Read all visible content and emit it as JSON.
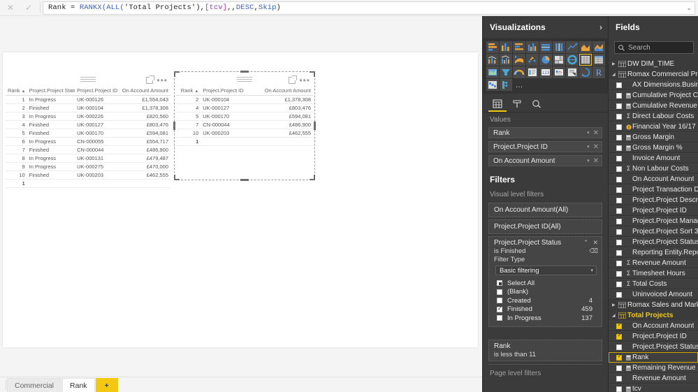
{
  "formula_bar": {
    "cancel_icon": "cancel-x-icon",
    "commit_icon": "commit-check-icon",
    "measure_name": "Rank ",
    "equals": "= ",
    "fn_rankx": "RANKX(",
    "all_open": "ALL(",
    "table_ref": "'Total Projects')",
    "comma1": ",",
    "field_tcv": "[tcv]",
    "tail": ",,",
    "desc": "DESC",
    "comma2": ",",
    "skip": "Skip",
    "close": ")",
    "expand_icon": "chevron-down-icon"
  },
  "canvas": {
    "page_tabs": [
      {
        "label": "Commercial",
        "state": "inactive"
      },
      {
        "label": "Rank",
        "state": "active"
      },
      {
        "label": "+",
        "state": "add"
      }
    ],
    "visual_1": {
      "drag_handle": "drag-handle-icon",
      "focus_icon": "focus-mode-icon",
      "more_icon": "more-options-icon",
      "columns": [
        "Rank",
        "Project.Project Status",
        "Project.Project ID",
        "On Account Amount"
      ],
      "sort_indicator": "▲",
      "rows": [
        [
          "1",
          "In Progress",
          "UK-000126",
          "£1,554,043"
        ],
        [
          "2",
          "Finished",
          "UK-000104",
          "£1,378,308"
        ],
        [
          "3",
          "In Progress",
          "UK-000226",
          "£820,560"
        ],
        [
          "4",
          "Finished",
          "UK-000127",
          "£803,476"
        ],
        [
          "5",
          "Finished",
          "UK-000170",
          "£594,081"
        ],
        [
          "6",
          "In Progress",
          "CN-000055",
          "£554,717"
        ],
        [
          "7",
          "Finished",
          "CN-000044",
          "£486,900"
        ],
        [
          "8",
          "In Progress",
          "UK-000131",
          "£479,487"
        ],
        [
          "9",
          "In Progress",
          "UK-000275",
          "£470,000"
        ],
        [
          "10",
          "Finished",
          "UK-000203",
          "£462,555"
        ]
      ],
      "total_row": [
        "1",
        "",
        "",
        ""
      ]
    },
    "visual_2": {
      "drag_handle": "drag-handle-icon",
      "focus_icon": "focus-mode-icon",
      "more_icon": "more-options-icon",
      "selected": true,
      "columns": [
        "Rank",
        "Project.Project ID",
        "On Account Amount"
      ],
      "sort_indicator": "▲",
      "rows": [
        [
          "2",
          "UK-000104",
          "£1,378,308"
        ],
        [
          "4",
          "UK-000127",
          "£803,476"
        ],
        [
          "5",
          "UK-000170",
          "£594,081"
        ],
        [
          "7",
          "CN-000044",
          "£486,900"
        ],
        [
          "10",
          "UK-000203",
          "£462,555"
        ]
      ],
      "total_row": [
        "1",
        "",
        ""
      ]
    }
  },
  "visualizations": {
    "title": "Visualizations",
    "collapse_icon": "chevron-right-icon",
    "gallery": [
      {
        "name": "stacked-bar-chart-icon",
        "selected": false
      },
      {
        "name": "stacked-column-chart-icon",
        "selected": false
      },
      {
        "name": "clustered-bar-chart-icon",
        "selected": false
      },
      {
        "name": "clustered-column-chart-icon",
        "selected": false
      },
      {
        "name": "100-stacked-bar-chart-icon",
        "selected": false
      },
      {
        "name": "100-stacked-column-chart-icon",
        "selected": false
      },
      {
        "name": "line-chart-icon",
        "selected": false
      },
      {
        "name": "area-chart-icon",
        "selected": false
      },
      {
        "name": "stacked-area-chart-icon",
        "selected": false
      },
      {
        "name": "line-stacked-column-chart-icon",
        "selected": false
      },
      {
        "name": "line-clustered-column-chart-icon",
        "selected": false
      },
      {
        "name": "ribbon-chart-icon",
        "selected": false
      },
      {
        "name": "scatter-chart-icon",
        "selected": false
      },
      {
        "name": "pie-chart-icon",
        "selected": false
      },
      {
        "name": "treemap-icon",
        "selected": false
      },
      {
        "name": "donut-chart-icon",
        "selected": false
      },
      {
        "name": "table-icon",
        "selected": true
      },
      {
        "name": "matrix-icon",
        "selected": false
      },
      {
        "name": "map-icon",
        "selected": false
      },
      {
        "name": "funnel-chart-icon",
        "selected": false
      },
      {
        "name": "gauge-icon",
        "selected": false
      },
      {
        "name": "multi-row-card-icon",
        "selected": false
      },
      {
        "name": "card-icon",
        "selected": false
      },
      {
        "name": "kpi-icon",
        "selected": false
      },
      {
        "name": "slicer-icon",
        "selected": false
      },
      {
        "name": "python-visual-icon",
        "selected": false
      },
      {
        "name": "r-script-visual-icon",
        "selected": false
      },
      {
        "name": "waterfall-chart-icon",
        "selected": false
      },
      {
        "name": "decomposition-tree-icon",
        "selected": false
      }
    ],
    "more_visuals_label": "…",
    "tabs": [
      {
        "name": "fields-tab",
        "icon": "fields-grid-icon",
        "active": true
      },
      {
        "name": "format-tab",
        "icon": "paint-roller-icon",
        "active": false
      },
      {
        "name": "analytics-tab",
        "icon": "magnifier-icon",
        "active": false
      }
    ],
    "values_label": "Values",
    "values": [
      {
        "label": "Rank",
        "caret": "▾",
        "remove": "✕"
      },
      {
        "label": "Project.Project ID",
        "caret": "▾",
        "remove": "✕"
      },
      {
        "label": "On Account Amount",
        "caret": "▾",
        "remove": "✕"
      }
    ],
    "filters_title": "Filters",
    "visual_level_label": "Visual level filters",
    "visual_filters": [
      {
        "title": "On Account Amount(All)",
        "expanded": false
      },
      {
        "title": "Project.Project ID(All)",
        "expanded": false
      }
    ],
    "active_filter": {
      "title": "Project.Project Status",
      "collapse_icon": "chevron-up-icon",
      "remove_icon": "close-icon",
      "condition": "is Finished",
      "clear_icon": "eraser-icon",
      "filter_type_label": "Filter Type",
      "filter_type_value": "Basic filtering",
      "dropdown_icon": "chevron-down-icon",
      "options": [
        {
          "label": "Select All",
          "state": "partial",
          "count": ""
        },
        {
          "label": "(Blank)",
          "state": "off",
          "count": ""
        },
        {
          "label": "Created",
          "state": "off",
          "count": "4"
        },
        {
          "label": "Finished",
          "state": "on",
          "count": "459"
        },
        {
          "label": "In Progress",
          "state": "off",
          "count": "137"
        }
      ]
    },
    "rank_filter": {
      "title": "Rank",
      "condition": "is less than 11"
    },
    "page_level_label": "Page level filters"
  },
  "fields": {
    "title": "Fields",
    "search_icon": "search-icon",
    "search_placeholder": "Search",
    "tree": [
      {
        "type": "table",
        "label": "DW DIM_TIME",
        "arrow": "▶",
        "expanded": false,
        "highlight": false
      },
      {
        "type": "table",
        "label": "Romax Commercial Project",
        "arrow": "◢",
        "expanded": true,
        "highlight": false
      },
      {
        "type": "field",
        "label": "AX Dimensions.Business",
        "checked": false,
        "icon": "none"
      },
      {
        "type": "field",
        "label": "Cumulative Project Cost",
        "checked": false,
        "icon": "measure"
      },
      {
        "type": "field",
        "label": "Cumulative Revenue",
        "checked": false,
        "icon": "measure"
      },
      {
        "type": "field",
        "label": "Direct Labour Costs",
        "checked": false,
        "icon": "sigma"
      },
      {
        "type": "field",
        "label": "Financial Year 16/17",
        "checked": false,
        "icon": "warning"
      },
      {
        "type": "field",
        "label": "Gross Margin",
        "checked": false,
        "icon": "measure"
      },
      {
        "type": "field",
        "label": "Gross Margin %",
        "checked": false,
        "icon": "measure"
      },
      {
        "type": "field",
        "label": "Invoice Amount",
        "checked": false,
        "icon": "none"
      },
      {
        "type": "field",
        "label": "Non Labour Costs",
        "checked": false,
        "icon": "sigma"
      },
      {
        "type": "field",
        "label": "On Account Amount",
        "checked": false,
        "icon": "none"
      },
      {
        "type": "field",
        "label": "Project Transaction Detail",
        "checked": false,
        "icon": "none"
      },
      {
        "type": "field",
        "label": "Project.Project Description",
        "checked": false,
        "icon": "none"
      },
      {
        "type": "field",
        "label": "Project.Project ID",
        "checked": false,
        "icon": "none"
      },
      {
        "type": "field",
        "label": "Project.Project Manager",
        "checked": false,
        "icon": "none"
      },
      {
        "type": "field",
        "label": "Project.Project Sort 3",
        "checked": false,
        "icon": "none"
      },
      {
        "type": "field",
        "label": "Project.Project Status",
        "checked": false,
        "icon": "none"
      },
      {
        "type": "field",
        "label": "Reporting Entity.Reporting",
        "checked": false,
        "icon": "none"
      },
      {
        "type": "field",
        "label": "Revenue Amount",
        "checked": false,
        "icon": "sigma"
      },
      {
        "type": "field",
        "label": "Timesheet Hours",
        "checked": false,
        "icon": "sigma"
      },
      {
        "type": "field",
        "label": "Total Costs",
        "checked": false,
        "icon": "sigma"
      },
      {
        "type": "field",
        "label": "Uninvoiced Amount",
        "checked": false,
        "icon": "none"
      },
      {
        "type": "table",
        "label": "Romax Sales and Marketing",
        "arrow": "▶",
        "expanded": false,
        "highlight": false
      },
      {
        "type": "table",
        "label": "Total Projects",
        "arrow": "◢",
        "expanded": true,
        "highlight": true
      },
      {
        "type": "field",
        "label": "On Account Amount",
        "checked": true,
        "icon": "none"
      },
      {
        "type": "field",
        "label": "Project.Project ID",
        "checked": true,
        "icon": "none"
      },
      {
        "type": "field",
        "label": "Project.Project Status",
        "checked": false,
        "icon": "none"
      },
      {
        "type": "field",
        "label": "Rank",
        "checked": true,
        "icon": "measure",
        "selected": true
      },
      {
        "type": "field",
        "label": "Remaining Revenue",
        "checked": false,
        "icon": "measure"
      },
      {
        "type": "field",
        "label": "Revenue Amount",
        "checked": false,
        "icon": "none"
      },
      {
        "type": "field",
        "label": "tcv",
        "checked": false,
        "icon": "measure"
      }
    ]
  }
}
